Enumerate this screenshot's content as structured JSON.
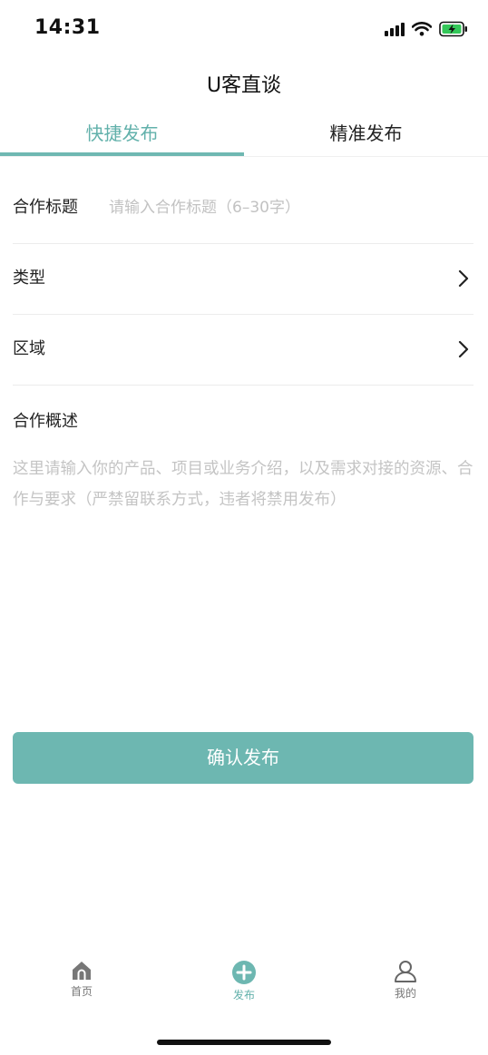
{
  "status": {
    "time": "14:31"
  },
  "nav": {
    "title": "U客直谈"
  },
  "tabs": {
    "quick": "快捷发布",
    "precise": "精准发布"
  },
  "form": {
    "title_label": "合作标题",
    "title_placeholder": "请输入合作标题（6–30字）",
    "type_label": "类型",
    "region_label": "区域",
    "desc_label": "合作概述",
    "desc_placeholder": "这里请输入你的产品、项目或业务介绍，以及需求对接的资源、合作与要求（严禁留联系方式，违者将禁用发布）"
  },
  "confirm_button": "确认发布",
  "tabbar": {
    "home": "首页",
    "publish": "发布",
    "mine": "我的"
  },
  "colors": {
    "accent": "#6db7b1",
    "accent_text": "#62b1ab"
  }
}
